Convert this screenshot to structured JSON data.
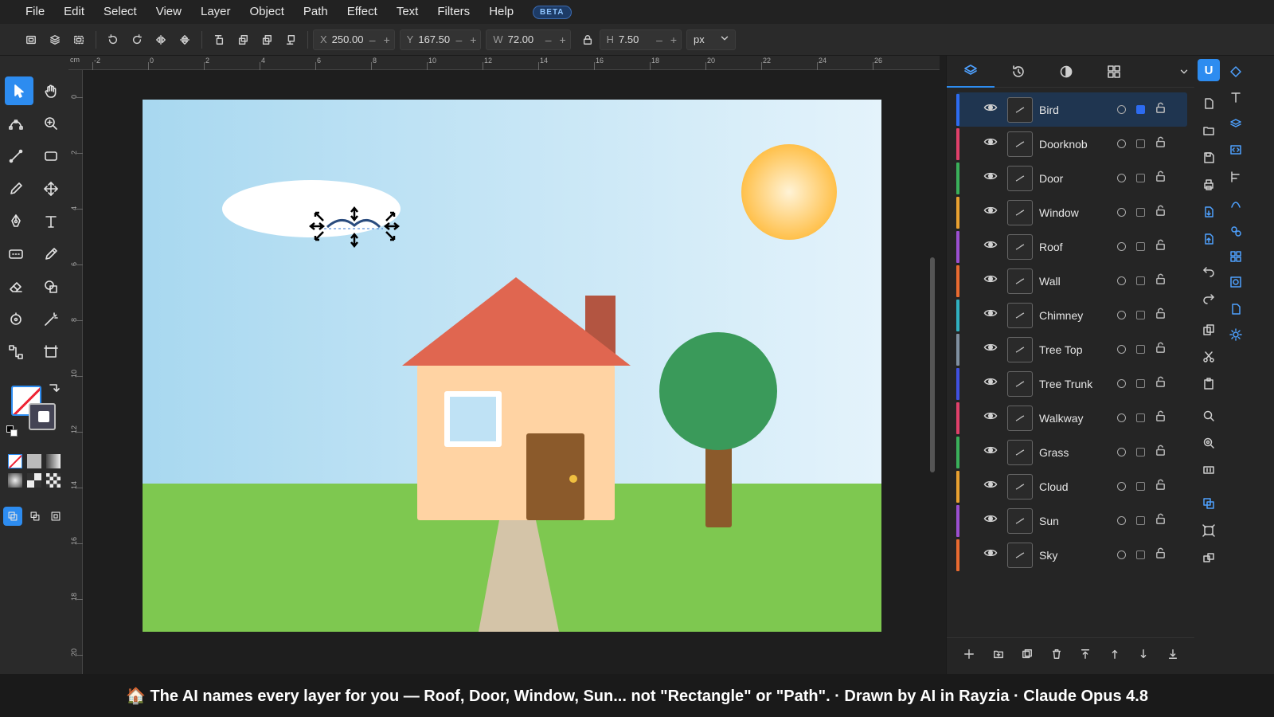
{
  "menu": {
    "items": [
      "File",
      "Edit",
      "Select",
      "View",
      "Layer",
      "Object",
      "Path",
      "Effect",
      "Text",
      "Filters",
      "Help"
    ],
    "badge": "BETA"
  },
  "toolbar": {
    "x_label": "X",
    "x_value": "250.00",
    "y_label": "Y",
    "y_value": "167.50",
    "w_label": "W",
    "w_value": "72.00",
    "h_label": "H",
    "h_value": "7.50",
    "minus": "–",
    "plus": "+",
    "unit": "px",
    "ruler_unit": "cm"
  },
  "ruler": {
    "top_labels": [
      "-2",
      "0",
      "2",
      "4",
      "6",
      "8",
      "10",
      "12",
      "14",
      "16",
      "18",
      "20",
      "22",
      "24",
      "26"
    ],
    "left_labels": [
      "0",
      "2",
      "4",
      "6",
      "8",
      "10",
      "12",
      "14",
      "16",
      "18",
      "20"
    ]
  },
  "artboard": {
    "sky_top": "#a8d8f0",
    "sky_bottom": "#e4f3fb",
    "grass": "#7ec850",
    "walkway": "#d4c4a8",
    "wall": "#ffd3a3",
    "roof": "#e06650",
    "chimney": "#b35541",
    "window": "#bfe2f5",
    "door": "#8b5a2b",
    "doorknob": "#f0c040",
    "tree_top": "#3a9a5a",
    "tree_trunk": "#8b5a2b",
    "sun": "#ffc04a",
    "cloud": "#ffffff"
  },
  "panel": {
    "tabs": [
      "layers-icon",
      "history-icon",
      "contrast-icon",
      "components-icon"
    ],
    "layers": [
      {
        "name": "Bird",
        "color": "#2d6bf0",
        "selected": true
      },
      {
        "name": "Doorknob",
        "color": "#e0406a",
        "selected": false
      },
      {
        "name": "Door",
        "color": "#3ab05a",
        "selected": false
      },
      {
        "name": "Window",
        "color": "#e8a030",
        "selected": false
      },
      {
        "name": "Roof",
        "color": "#9b4fd0",
        "selected": false
      },
      {
        "name": "Wall",
        "color": "#e86a30",
        "selected": false
      },
      {
        "name": "Chimney",
        "color": "#30b0c0",
        "selected": false
      },
      {
        "name": "Tree Top",
        "color": "#8090a0",
        "selected": false
      },
      {
        "name": "Tree Trunk",
        "color": "#4050e0",
        "selected": false
      },
      {
        "name": "Walkway",
        "color": "#e0406a",
        "selected": false
      },
      {
        "name": "Grass",
        "color": "#3ab05a",
        "selected": false
      },
      {
        "name": "Cloud",
        "color": "#e8a030",
        "selected": false
      },
      {
        "name": "Sun",
        "color": "#9b4fd0",
        "selected": false
      },
      {
        "name": "Sky",
        "color": "#e86a30",
        "selected": false
      }
    ]
  },
  "user": {
    "avatar_letter": "U"
  },
  "banner": {
    "text": "🏠 The AI names every layer for you — Roof, Door, Window, Sun... not \"Rectangle\" or \"Path\". · Drawn by AI in Rayzia · Claude Opus 4.8"
  }
}
